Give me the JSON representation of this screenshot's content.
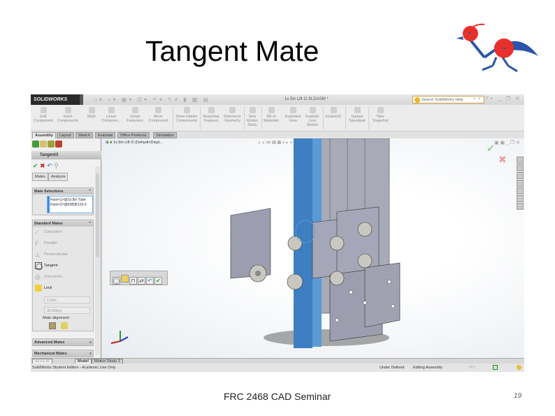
{
  "slide": {
    "title": "Tangent Mate",
    "footer": "FRC 2468 CAD Seminar",
    "page_number": "19"
  },
  "app": {
    "brand": "SOLIDWORKS",
    "document_title": "1x.5in Lift I2.SLDASM *",
    "search_placeholder": "Search SolidWorks Help"
  },
  "ribbon": [
    {
      "label": "Edit Component"
    },
    {
      "label": "Insert Components"
    },
    {
      "label": "Mate"
    },
    {
      "label": "Linear Compone..."
    },
    {
      "label": "Smart Fasteners"
    },
    {
      "label": "Move Component"
    },
    {
      "label": "Show Hidden Components"
    },
    {
      "label": "Assembly Features"
    },
    {
      "label": "Reference Geometry"
    },
    {
      "label": "New Motion Study"
    },
    {
      "label": "Bill of Materials"
    },
    {
      "label": "Exploded View"
    },
    {
      "label": "Explode Line Sketch"
    },
    {
      "label": "Instant3D"
    },
    {
      "label": "Update Speedpak"
    },
    {
      "label": "Take Snapshot"
    }
  ],
  "tabs": [
    "Assembly",
    "Layout",
    "Sketch",
    "Evaluate",
    "Office Products",
    "Simulation"
  ],
  "panel": {
    "feature_name": "Tangent3",
    "subtabs": [
      "Mates",
      "Analysis"
    ],
    "mate_selections": {
      "title": "Mate Selections",
      "items": [
        "Face<1>@1x.5in Tube",
        "Face<2>@6383K110-3"
      ]
    },
    "standard_mates": {
      "title": "Standard Mates",
      "items": [
        "Coincident",
        "Parallel",
        "Perpendicular",
        "Tangent",
        "Concentric",
        "Lock"
      ],
      "selected": "Tangent",
      "distance": "0.00in",
      "angle": "30.00deg",
      "alignment_label": "Mate alignment:"
    },
    "advanced": "Advanced Mates",
    "mechanical": "Mechanical Mates"
  },
  "tree": {
    "root": "1x.5in Lift I2  (Default<Displ..."
  },
  "bottom_tabs": [
    "Model",
    "Motion Study 1"
  ],
  "status": {
    "edition": "SolidWorks Student Edition - Academic Use Only",
    "state": "Under Defined",
    "mode": "Editing Assembly",
    "units": "IPS"
  },
  "colors": {
    "accent_blue": "#3d7fc0",
    "part_gray": "#9c9eb0",
    "ok_green": "#2e9e2e",
    "cancel_red": "#d02020"
  }
}
